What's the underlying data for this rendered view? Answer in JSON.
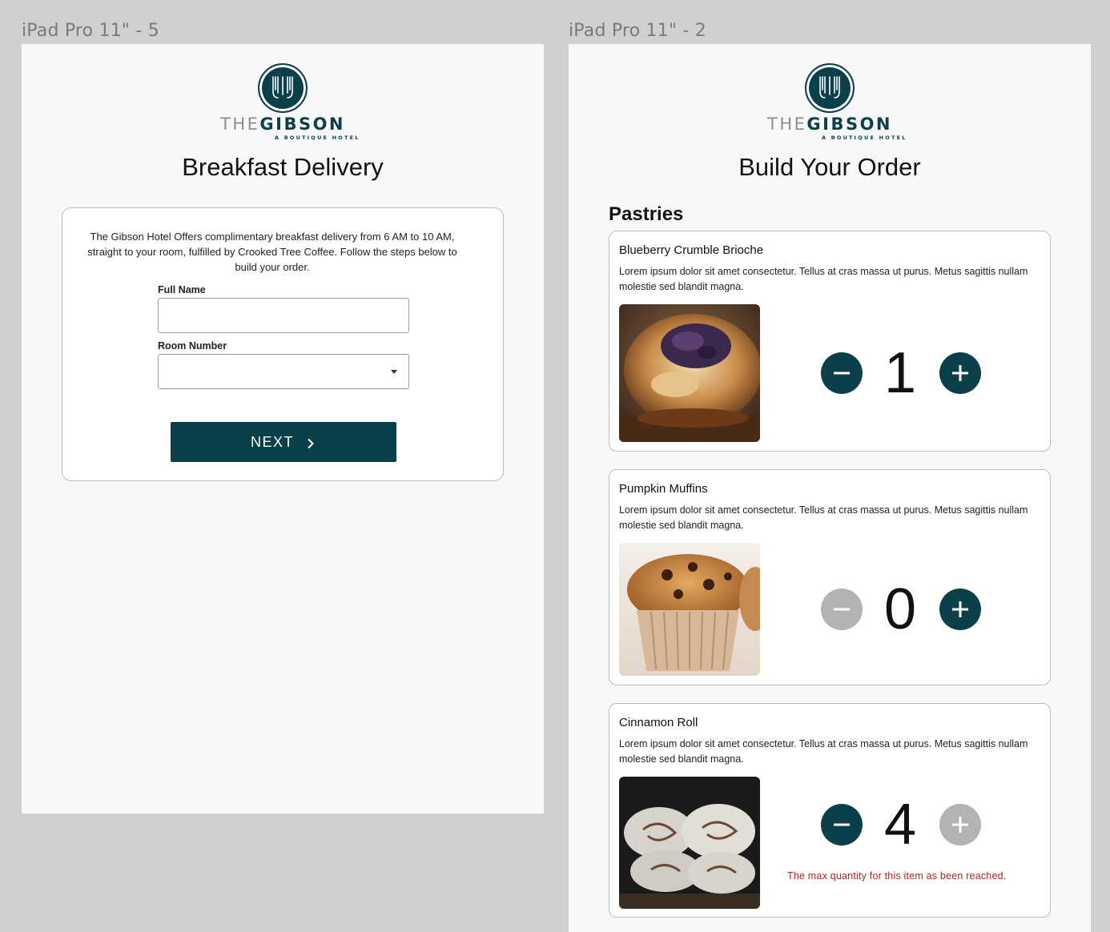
{
  "frames": [
    {
      "label": "iPad Pro 11\" - 5",
      "logo": {
        "the": "THE",
        "gibson": "GIBSON",
        "tagline": "A BOUTIQUE HOTEL"
      },
      "title": "Breakfast Delivery",
      "intro": "The Gibson Hotel Offers complimentary breakfast delivery from 6 AM to 10 AM, straight to your room, fulfilled by Crooked Tree Coffee. Follow the steps below to build your order.",
      "form": {
        "full_name_label": "Full Name",
        "full_name_value": "",
        "room_number_label": "Room Number",
        "room_number_value": ""
      },
      "next_label": "NEXT"
    },
    {
      "label": "iPad Pro 11\" - 2",
      "logo": {
        "the": "THE",
        "gibson": "GIBSON",
        "tagline": "A BOUTIQUE HOTEL"
      },
      "title": "Build Your Order",
      "section": "Pastries",
      "items": [
        {
          "name": "Blueberry Crumble Brioche",
          "description": "Lorem ipsum dolor sit amet consectetur. Tellus at cras massa ut purus. Metus sagittis nullam molestie sed blandit magna.",
          "quantity": "1",
          "minus_enabled": true,
          "plus_enabled": true,
          "message": ""
        },
        {
          "name": "Pumpkin Muffins",
          "description": "Lorem ipsum dolor sit amet consectetur. Tellus at cras massa ut purus. Metus sagittis nullam molestie sed blandit magna.",
          "quantity": "0",
          "minus_enabled": false,
          "plus_enabled": true,
          "message": ""
        },
        {
          "name": "Cinnamon Roll",
          "description": "Lorem ipsum dolor sit amet consectetur. Tellus at cras massa ut purus. Metus sagittis nullam molestie sed blandit magna.",
          "quantity": "4",
          "minus_enabled": true,
          "plus_enabled": false,
          "message": "The max quantity for this item as been reached."
        }
      ]
    }
  ],
  "colors": {
    "brand": "#0b3f4a",
    "disabled": "#b3b3b3",
    "error": "#b32222",
    "canvas": "#d0d0d0"
  },
  "icons": [
    "hotel-emblem-icon",
    "chevron-right-icon",
    "caret-down-icon",
    "minus-icon",
    "plus-icon"
  ]
}
